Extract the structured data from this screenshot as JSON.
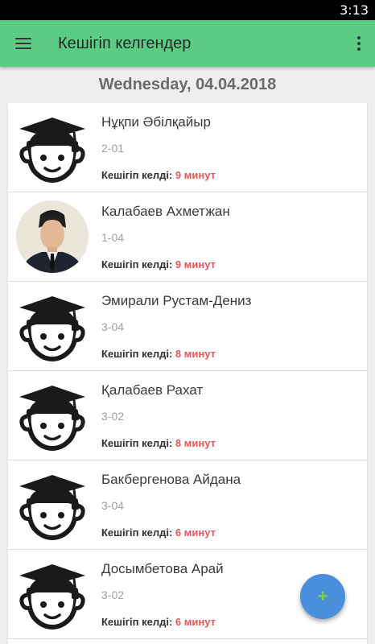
{
  "status": {
    "time": "3:13"
  },
  "toolbar": {
    "title": "Кешігіп келгендер",
    "menu_icon": "menu-icon",
    "more_icon": "more-vert-icon"
  },
  "date": "Wednesday, 04.04.2018",
  "late_label": "Кешігіп келді:",
  "students": [
    {
      "name": "Нұқпи Әбілқайыр",
      "room": "2-01",
      "late": "9 минут",
      "avatar": "graduate-icon"
    },
    {
      "name": "Калабаев Ахметжан",
      "room": "1-04",
      "late": "9 минут",
      "avatar": "photo"
    },
    {
      "name": "Эмирали Рустам-Дениз",
      "room": "3-04",
      "late": "8 минут",
      "avatar": "graduate-icon"
    },
    {
      "name": "Қалабаев Рахат",
      "room": "3-02",
      "late": "8 минут",
      "avatar": "graduate-icon"
    },
    {
      "name": "Бакбергенова Айдана",
      "room": "3-04",
      "late": "6 минут",
      "avatar": "graduate-icon"
    },
    {
      "name": "Досымбетова Арай",
      "room": "3-02",
      "late": "6 минут",
      "avatar": "graduate-icon"
    }
  ],
  "fab": {
    "label": "+",
    "accent": "#4a8fdb",
    "plus_color": "#7fd14a"
  },
  "colors": {
    "appbar": "#5ccb84",
    "late_value": "#e45a5a"
  }
}
